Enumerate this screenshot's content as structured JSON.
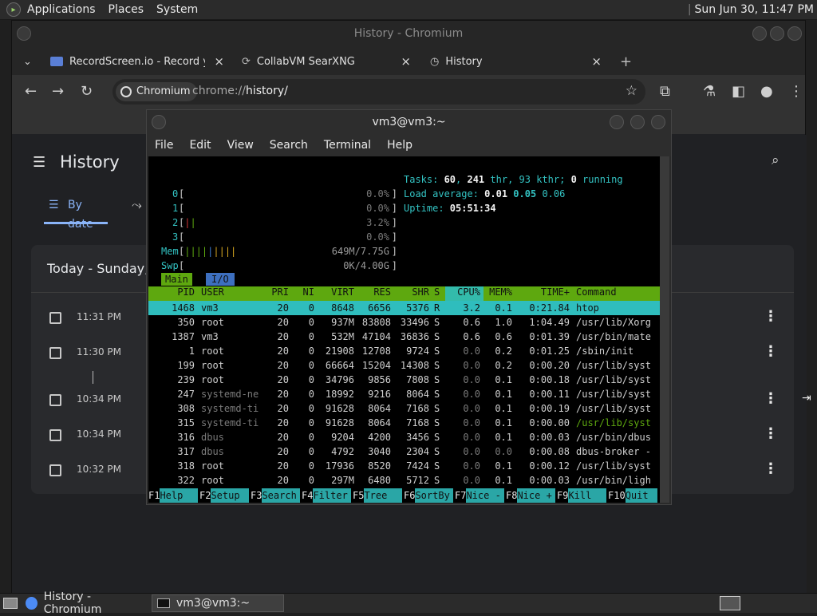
{
  "topbar": {
    "menus": [
      "Applications",
      "Places",
      "System"
    ],
    "clock": "Sun Jun 30, 11:47 PM"
  },
  "chrome": {
    "title": "History - Chromium",
    "tabs": [
      {
        "label": "RecordScreen.io - Record you"
      },
      {
        "label": "CollabVM SearXNG"
      },
      {
        "label": "History"
      }
    ],
    "url_chip": "Chromium",
    "url_prefix": "chrome://",
    "url_path": "history/",
    "history": {
      "title": "History",
      "tab_by_date": "By date",
      "card_heading": "Today - Sunday, J",
      "rows": [
        {
          "time": "11:31 PM"
        },
        {
          "time": "11:30 PM"
        },
        {
          "time": "10:34 PM"
        },
        {
          "time": "10:34 PM"
        },
        {
          "time": "10:32 PM"
        }
      ]
    }
  },
  "terminal": {
    "title": "vm3@vm3:~",
    "menu": [
      "File",
      "Edit",
      "View",
      "Search",
      "Terminal",
      "Help"
    ],
    "cpu": [
      {
        "id": "0",
        "pct": "0.0%"
      },
      {
        "id": "1",
        "pct": "0.0%"
      },
      {
        "id": "2",
        "pct": "3.2%"
      },
      {
        "id": "3",
        "pct": "0.0%"
      }
    ],
    "mem": "649M/7.75G",
    "swp": "0K/4.00G",
    "tasks": {
      "tasks": "60",
      "thr": "241",
      "kthr": "93",
      "running": "0"
    },
    "load": {
      "a": "0.01",
      "b": "0.05",
      "c": "0.06"
    },
    "uptime": "05:51:34",
    "tab_main": "Main",
    "tab_io": "I/O",
    "columns": [
      "PID",
      "USER",
      "PRI",
      "NI",
      "VIRT",
      "RES",
      "SHR",
      "S",
      "CPU%",
      "MEM%",
      "TIME+",
      "Command"
    ],
    "processes": [
      {
        "pid": "1468",
        "user": "vm3",
        "pri": "20",
        "ni": "0",
        "virt": "8648",
        "res": "6656",
        "shr": "5376",
        "s": "R",
        "cpu": "3.2",
        "mem": "0.1",
        "time": "0:21.84",
        "cmd": "htop"
      },
      {
        "pid": "350",
        "user": "root",
        "pri": "20",
        "ni": "0",
        "virt": "937M",
        "res": "83808",
        "shr": "33496",
        "s": "S",
        "cpu": "0.6",
        "mem": "1.0",
        "time": "1:04.49",
        "cmd": "/usr/lib/Xorg"
      },
      {
        "pid": "1387",
        "user": "vm3",
        "pri": "20",
        "ni": "0",
        "virt": "532M",
        "res": "47104",
        "shr": "36836",
        "s": "S",
        "cpu": "0.6",
        "mem": "0.6",
        "time": "0:01.39",
        "cmd": "/usr/bin/mate"
      },
      {
        "pid": "1",
        "user": "root",
        "pri": "20",
        "ni": "0",
        "virt": "21908",
        "res": "12708",
        "shr": "9724",
        "s": "S",
        "cpu": "0.0",
        "mem": "0.2",
        "time": "0:01.25",
        "cmd": "/sbin/init"
      },
      {
        "pid": "199",
        "user": "root",
        "pri": "20",
        "ni": "0",
        "virt": "66664",
        "res": "15204",
        "shr": "14308",
        "s": "S",
        "cpu": "0.0",
        "mem": "0.2",
        "time": "0:00.20",
        "cmd": "/usr/lib/syst"
      },
      {
        "pid": "239",
        "user": "root",
        "pri": "20",
        "ni": "0",
        "virt": "34796",
        "res": "9856",
        "shr": "7808",
        "s": "S",
        "cpu": "0.0",
        "mem": "0.1",
        "time": "0:00.18",
        "cmd": "/usr/lib/syst"
      },
      {
        "pid": "247",
        "user": "systemd-ne",
        "pri": "20",
        "ni": "0",
        "virt": "18992",
        "res": "9216",
        "shr": "8064",
        "s": "S",
        "cpu": "0.0",
        "mem": "0.1",
        "time": "0:00.11",
        "cmd": "/usr/lib/syst"
      },
      {
        "pid": "308",
        "user": "systemd-ti",
        "pri": "20",
        "ni": "0",
        "virt": "91628",
        "res": "8064",
        "shr": "7168",
        "s": "S",
        "cpu": "0.0",
        "mem": "0.1",
        "time": "0:00.19",
        "cmd": "/usr/lib/syst"
      },
      {
        "pid": "315",
        "user": "systemd-ti",
        "pri": "20",
        "ni": "0",
        "virt": "91628",
        "res": "8064",
        "shr": "7168",
        "s": "S",
        "cpu": "0.0",
        "mem": "0.1",
        "time": "0:00.00",
        "cmd": "/usr/lib/syst"
      },
      {
        "pid": "316",
        "user": "dbus",
        "pri": "20",
        "ni": "0",
        "virt": "9204",
        "res": "4200",
        "shr": "3456",
        "s": "S",
        "cpu": "0.0",
        "mem": "0.1",
        "time": "0:00.03",
        "cmd": "/usr/bin/dbus"
      },
      {
        "pid": "317",
        "user": "dbus",
        "pri": "20",
        "ni": "0",
        "virt": "4792",
        "res": "3040",
        "shr": "2304",
        "s": "S",
        "cpu": "0.0",
        "mem": "0.0",
        "time": "0:00.08",
        "cmd": "dbus-broker -"
      },
      {
        "pid": "318",
        "user": "root",
        "pri": "20",
        "ni": "0",
        "virt": "17936",
        "res": "8520",
        "shr": "7424",
        "s": "S",
        "cpu": "0.0",
        "mem": "0.1",
        "time": "0:00.12",
        "cmd": "/usr/lib/syst"
      },
      {
        "pid": "322",
        "user": "root",
        "pri": "20",
        "ni": "0",
        "virt": "297M",
        "res": "6480",
        "shr": "5712",
        "s": "S",
        "cpu": "0.0",
        "mem": "0.1",
        "time": "0:00.03",
        "cmd": "/usr/bin/ligh"
      }
    ],
    "fkeys": [
      {
        "n": "F1",
        "label": "Help"
      },
      {
        "n": "F2",
        "label": "Setup"
      },
      {
        "n": "F3",
        "label": "Search"
      },
      {
        "n": "F4",
        "label": "Filter"
      },
      {
        "n": "F5",
        "label": "Tree"
      },
      {
        "n": "F6",
        "label": "SortBy"
      },
      {
        "n": "F7",
        "label": "Nice -"
      },
      {
        "n": "F8",
        "label": "Nice +"
      },
      {
        "n": "F9",
        "label": "Kill"
      },
      {
        "n": "F10",
        "label": "Quit"
      }
    ]
  },
  "taskbar": {
    "items": [
      {
        "label": "History - Chromium"
      },
      {
        "label": "vm3@vm3:~"
      }
    ]
  },
  "colors": {
    "accent": "#8ab4f8",
    "htop_green": "#5ea80f",
    "htop_cyan": "#2fbdbd"
  }
}
